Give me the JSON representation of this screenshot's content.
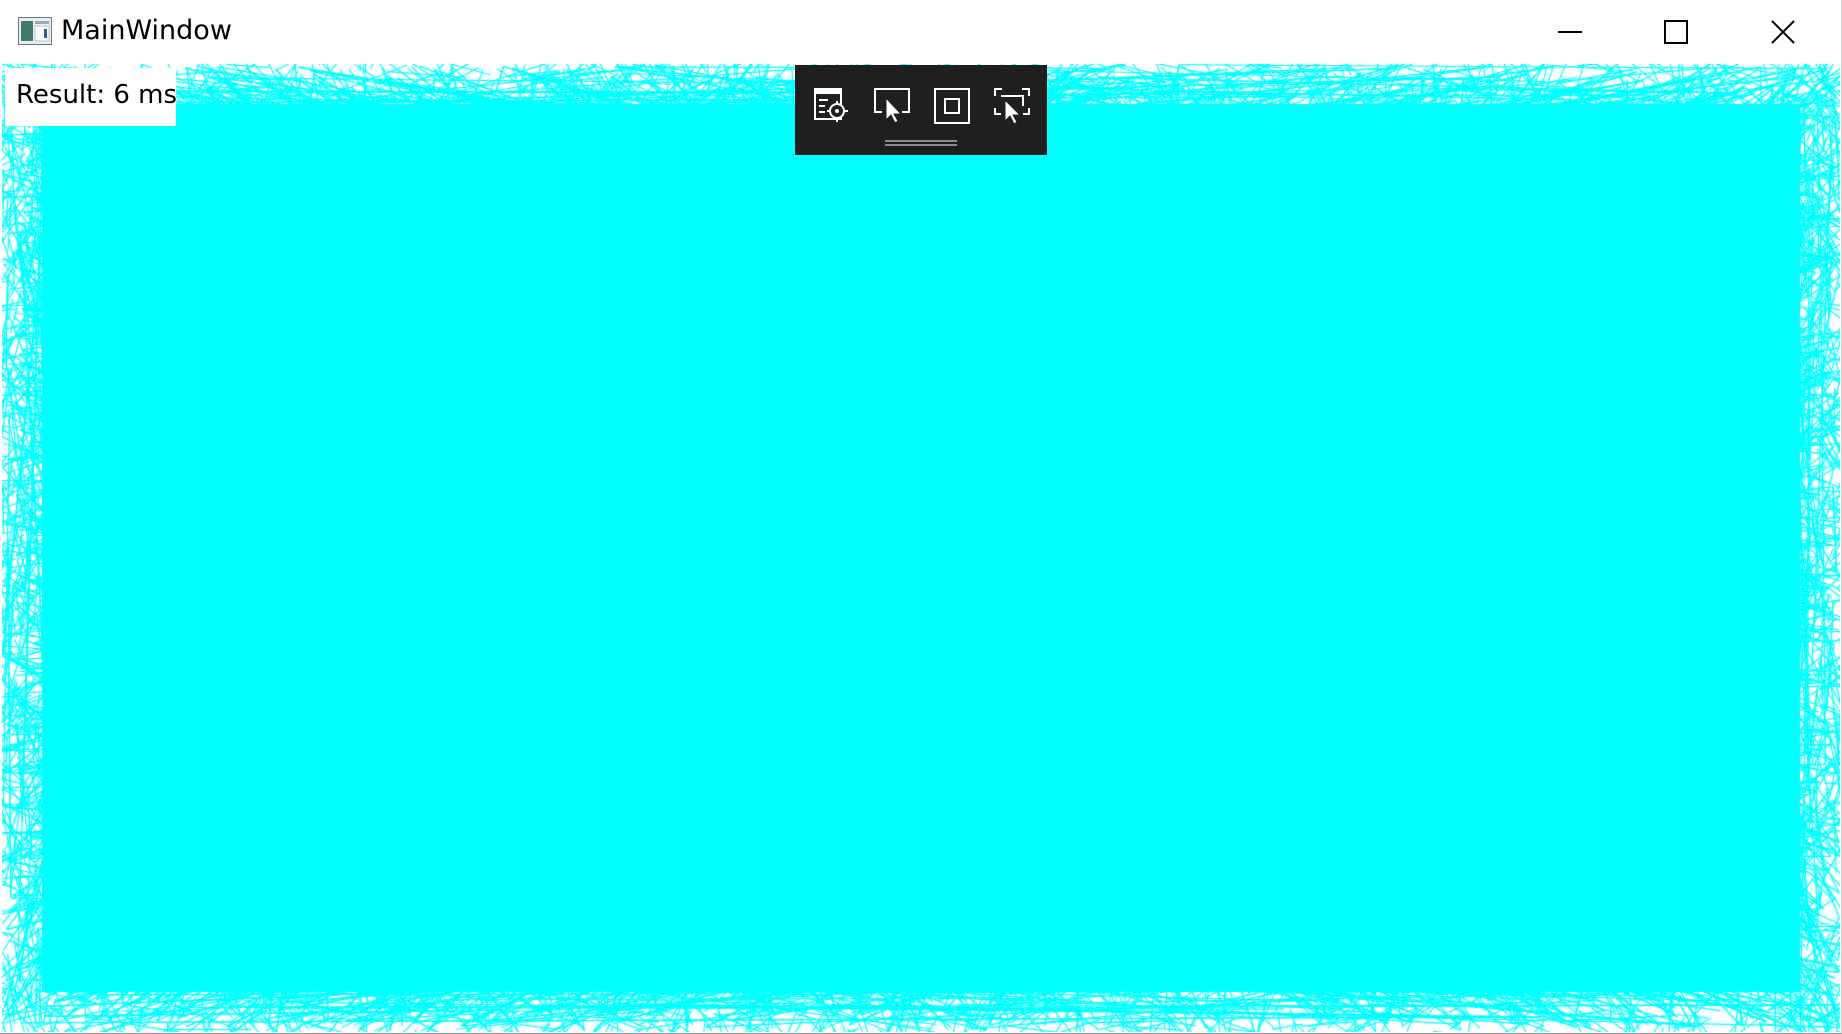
{
  "window": {
    "title": "MainWindow",
    "icon": "app-window-icon",
    "caption_buttons": [
      "minimize-icon",
      "maximize-icon",
      "close-icon"
    ]
  },
  "content": {
    "result_text": "Result: 6 ms",
    "canvas_color": "#00ffff",
    "background_color": "#ffffff"
  },
  "debug_toolbar": {
    "background": "#1f1f1f",
    "tools": [
      {
        "name": "go-to-live-visual-tree",
        "icon": "live-visual-tree-icon"
      },
      {
        "name": "select-element",
        "icon": "select-element-icon"
      },
      {
        "name": "display-layout-adorners",
        "icon": "layout-adorner-icon"
      },
      {
        "name": "track-focused-element",
        "icon": "track-focus-icon"
      }
    ]
  }
}
